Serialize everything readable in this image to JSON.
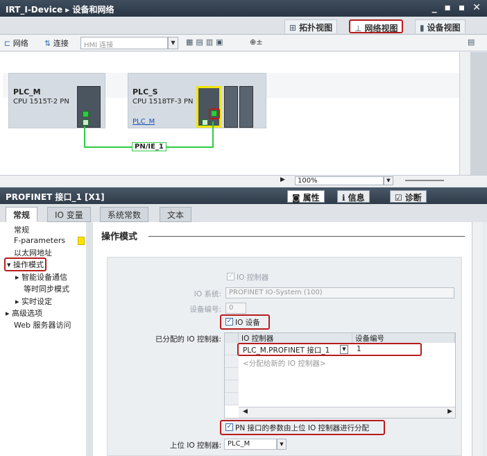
{
  "window": {
    "title": "IRT_I-Device  ▸  设备和网络",
    "controls": "_ ▪ ▪ ✕"
  },
  "view_tabs": {
    "topology": "拓扑视图",
    "network": "网络视图",
    "device": "设备视图"
  },
  "toolbar": {
    "network": "网络",
    "connect": "连接",
    "hmi_select": "HMI 连接",
    "zoom": "100%"
  },
  "devices": [
    {
      "name": "PLC_M",
      "type": "CPU 1515T-2 PN"
    },
    {
      "name": "PLC_S",
      "type": "CPU 1518TF-3 PN",
      "link": "PLC_M"
    }
  ],
  "network": {
    "label": "PN/IE_1"
  },
  "panel": {
    "title": "PROFINET 接口_1 [X1]",
    "properties": "属性",
    "info": "信息",
    "diagnostics": "诊断"
  },
  "subtabs": {
    "general": "常规",
    "io_vars": "IO 变量",
    "sys_const": "系统常数",
    "text": "文本"
  },
  "nav": {
    "general": "常规",
    "fparams": "F-parameters",
    "ethernet": "以太网地址",
    "opmode": "▾ 操作模式",
    "smart": "▸ 智能设备通信",
    "iso": "等时同步模式",
    "realtime": "▸ 实时设定",
    "advanced": "▸ 高级选项",
    "web": "Web 服务器访问"
  },
  "form": {
    "section": "操作模式",
    "io_controller": "IO 控制器",
    "io_system_label": "IO 系统:",
    "io_system_value": "PROFINET IO-System (100)",
    "device_no_label": "设备编号:",
    "device_no_value": "0",
    "io_device": "IO 设备",
    "assigned_label": "已分配的 IO 控制器:",
    "grid_col1": "IO 控制器",
    "grid_col2": "设备编号",
    "grid_row1_ctrl": "PLC_M.PROFINET 接口_1",
    "grid_row1_no": "1",
    "grid_placeholder": "<分配给新的 IO 控制器>",
    "param_assign": "PN 接口的参数由上位 IO 控制器进行分配",
    "upper_label": "上位 IO 控制器:",
    "upper_value": "PLC_M"
  }
}
